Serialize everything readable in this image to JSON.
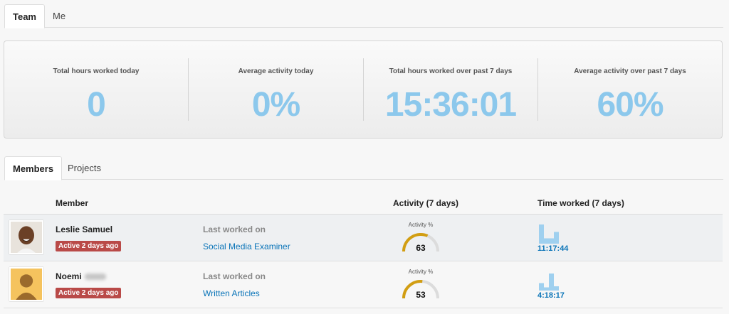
{
  "top_tabs": [
    {
      "label": "Team",
      "active": true
    },
    {
      "label": "Me",
      "active": false
    }
  ],
  "summary": [
    {
      "label": "Total hours worked today",
      "value": "0"
    },
    {
      "label": "Average activity today",
      "value": "0%"
    },
    {
      "label": "Total hours worked over past 7 days",
      "value": "15:36:01"
    },
    {
      "label": "Average activity over past 7 days",
      "value": "60%"
    }
  ],
  "sub_tabs": [
    {
      "label": "Members",
      "active": true
    },
    {
      "label": "Projects",
      "active": false
    }
  ],
  "table": {
    "headers": {
      "member": "Member",
      "activity": "Activity (7 days)",
      "time": "Time worked (7 days)"
    },
    "rows": [
      {
        "name": "Leslie Samuel",
        "status": "Active 2 days ago",
        "last_label": "Last worked on",
        "project": "Social Media Examiner",
        "gauge_label": "Activity %",
        "activity": 63,
        "time": "11:17:44",
        "bars": [
          0.9,
          0.25,
          0.25,
          0.55
        ]
      },
      {
        "name": "Noemi",
        "status": "Active 2 days ago",
        "last_label": "Last worked on",
        "project": "Written Articles",
        "gauge_label": "Activity %",
        "activity": 53,
        "time": "4:18:17",
        "bars": [
          0.35,
          0.15,
          0.8,
          0.2
        ]
      }
    ]
  },
  "colors": {
    "accent": "#8cc8ec",
    "badge": "#b94a48",
    "link": "#0a74b8",
    "gauge": "#d29e12"
  }
}
